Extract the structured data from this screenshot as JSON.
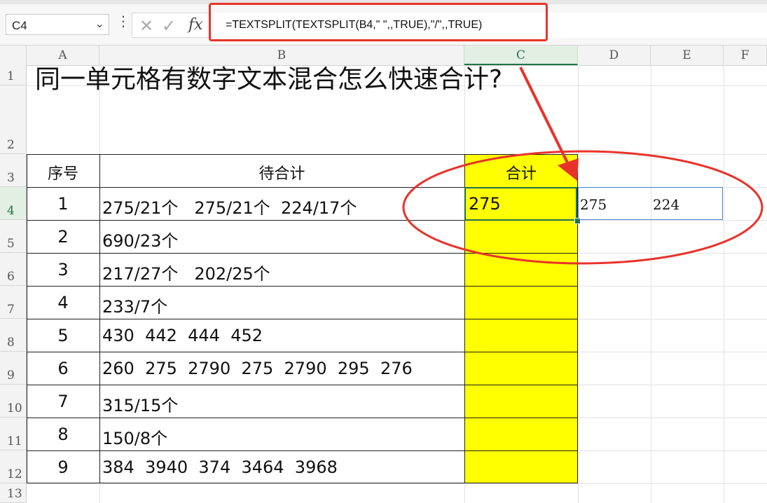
{
  "name_box": {
    "value": "C4"
  },
  "formula_bar": {
    "formula": "=TEXTSPLIT(TEXTSPLIT(B4,\" \",,TRUE),\"/\",,TRUE)"
  },
  "columns": [
    "A",
    "B",
    "C",
    "D",
    "E",
    "F"
  ],
  "rows": [
    "1",
    "2",
    "3",
    "4",
    "5",
    "6",
    "7",
    "8",
    "9",
    "10",
    "11",
    "12",
    "13"
  ],
  "sheet": {
    "title": "同一单元格有数字文本混合怎么快速合计?",
    "headers": {
      "index": "序号",
      "pending": "待合计",
      "total": "合计"
    },
    "data": [
      {
        "index": "1",
        "text": "275/21个   275/21个  224/17个"
      },
      {
        "index": "2",
        "text": "690/23个"
      },
      {
        "index": "3",
        "text": "217/27个   202/25个"
      },
      {
        "index": "4",
        "text": "233/7个"
      },
      {
        "index": "5",
        "text": "430  442  444  452"
      },
      {
        "index": "6",
        "text": "260  275  2790  275  2790  295  276"
      },
      {
        "index": "7",
        "text": "315/15个"
      },
      {
        "index": "8",
        "text": "150/8个"
      },
      {
        "index": "9",
        "text": "384  3940  374  3464  3968"
      }
    ],
    "c4_value": "275",
    "spill_values": [
      "275",
      "224"
    ]
  },
  "colors": {
    "highlight": "#ffff00",
    "annotation": "#e8332a",
    "selection": "#217346"
  }
}
